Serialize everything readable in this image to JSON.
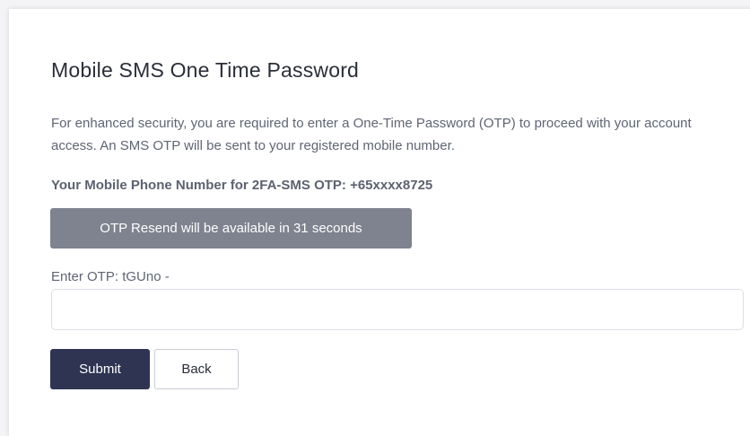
{
  "page": {
    "title": "Mobile SMS One Time Password",
    "description": "For enhanced security, you are required to enter a One-Time Password (OTP) to proceed with your account access. An SMS OTP will be sent to your registered mobile number.",
    "phone_line": "Your Mobile Phone Number for 2FA-SMS OTP: +65xxxx8725"
  },
  "resend": {
    "label": "OTP Resend will be available in 31 seconds",
    "color": "#7f828f"
  },
  "otp": {
    "label": "Enter OTP: tGUno -",
    "value": "",
    "placeholder": ""
  },
  "actions": {
    "submit_label": "Submit",
    "back_label": "Back",
    "submit_color": "#2e3452"
  }
}
